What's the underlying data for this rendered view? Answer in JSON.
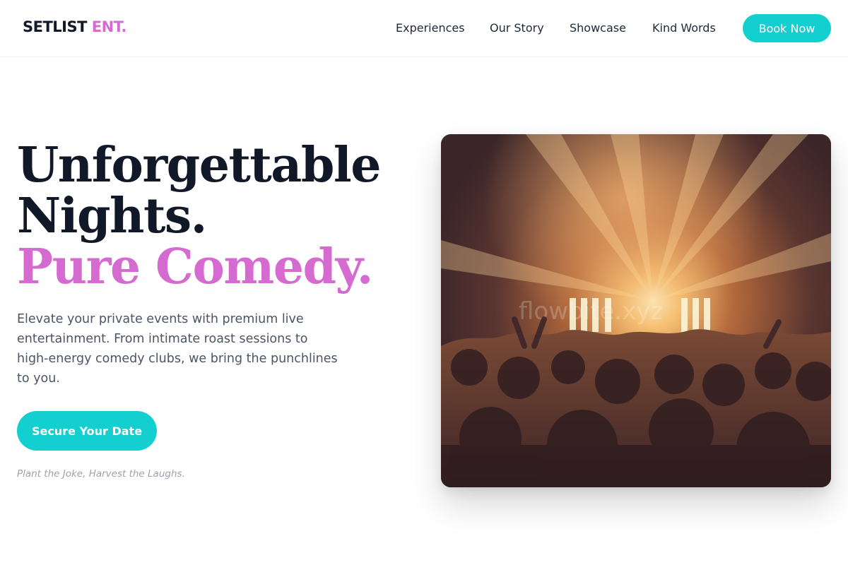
{
  "brand": {
    "name": "SETLIST",
    "accent": "ENT."
  },
  "nav": {
    "items": [
      {
        "label": "Experiences"
      },
      {
        "label": "Our Story"
      },
      {
        "label": "Showcase"
      },
      {
        "label": "Kind Words"
      }
    ],
    "cta_label": "Book Now"
  },
  "hero": {
    "headline_line1": "Unforgettable",
    "headline_line2": "Nights.",
    "headline_line3": "Pure Comedy.",
    "description": "Elevate your private events with premium live entertainment. From intimate roast sessions to high-energy comedy clubs, we bring the punchlines to you.",
    "cta_label": "Secure Your Date",
    "tagline": "Plant the Joke, Harvest the Laughs.",
    "image_watermark": "flowbite.xyz"
  },
  "colors": {
    "accent_pink": "#d56bd1",
    "accent_teal": "#14cfcf",
    "text_dark": "#111827",
    "text_muted": "#4b5563"
  }
}
